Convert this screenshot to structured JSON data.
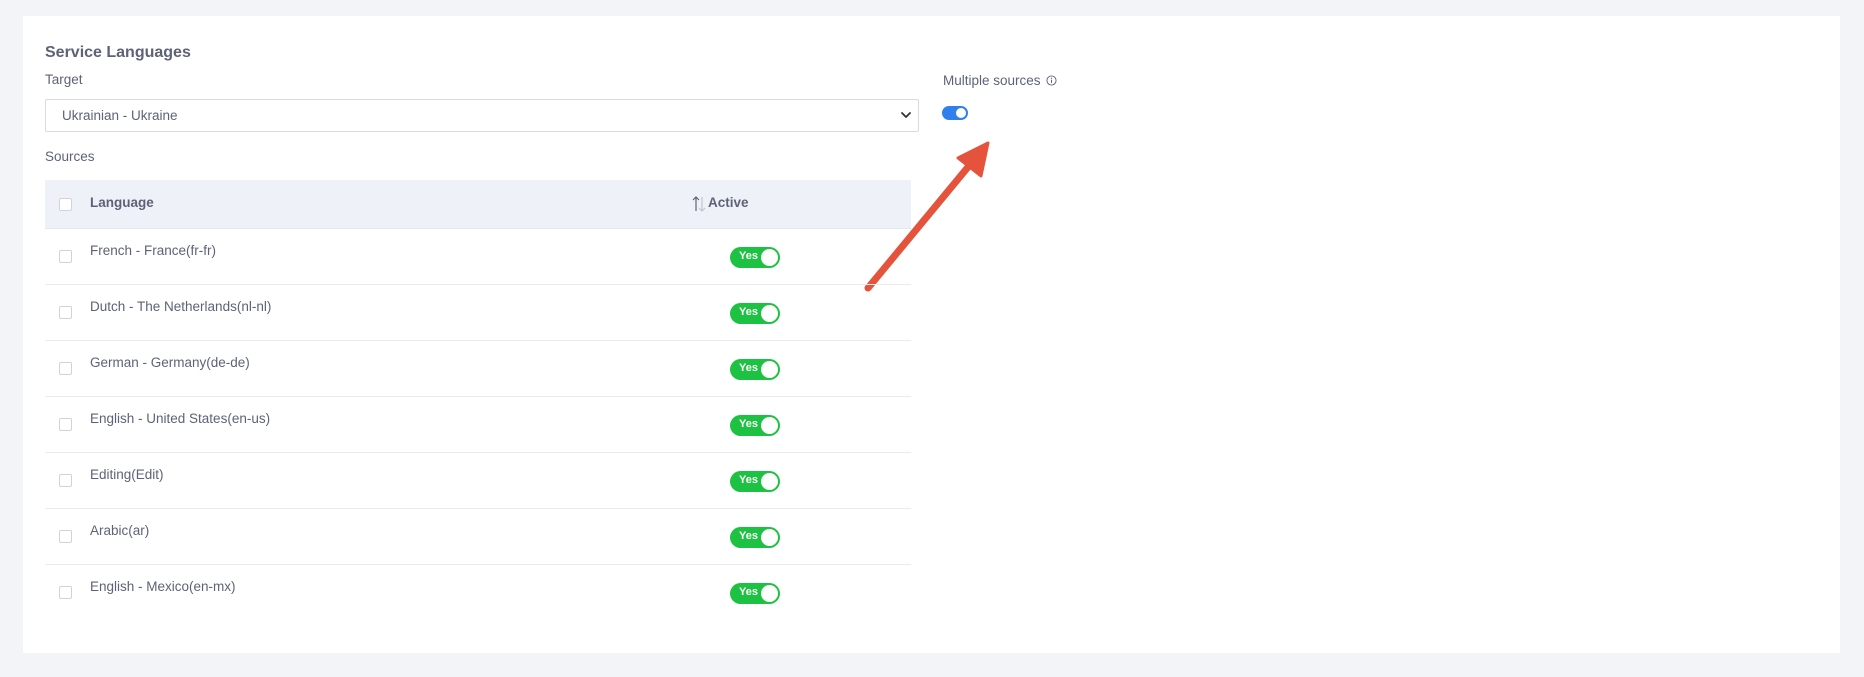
{
  "section": {
    "title": "Service Languages"
  },
  "target": {
    "label": "Target",
    "selected": "Ukrainian - Ukraine"
  },
  "sources": {
    "label": "Sources"
  },
  "multiple_sources": {
    "label": "Multiple sources",
    "enabled": true,
    "info_icon": "info-circle-icon"
  },
  "table": {
    "columns": [
      "Language",
      "Active"
    ],
    "rows": [
      {
        "language": "French - France(fr-fr)",
        "active": "Yes"
      },
      {
        "language": "Dutch - The Netherlands(nl-nl)",
        "active": "Yes"
      },
      {
        "language": "German - Germany(de-de)",
        "active": "Yes"
      },
      {
        "language": "English - United States(en-us)",
        "active": "Yes"
      },
      {
        "language": "Editing(Edit)",
        "active": "Yes"
      },
      {
        "language": "Arabic(ar)",
        "active": "Yes"
      },
      {
        "language": "English - Mexico(en-mx)",
        "active": "Yes"
      }
    ]
  },
  "colors": {
    "toggle_on_blue": "#2f80ed",
    "toggle_yes_green": "#1ec243",
    "arrow_red": "#e5533d",
    "header_bg": "#eef2f8"
  }
}
